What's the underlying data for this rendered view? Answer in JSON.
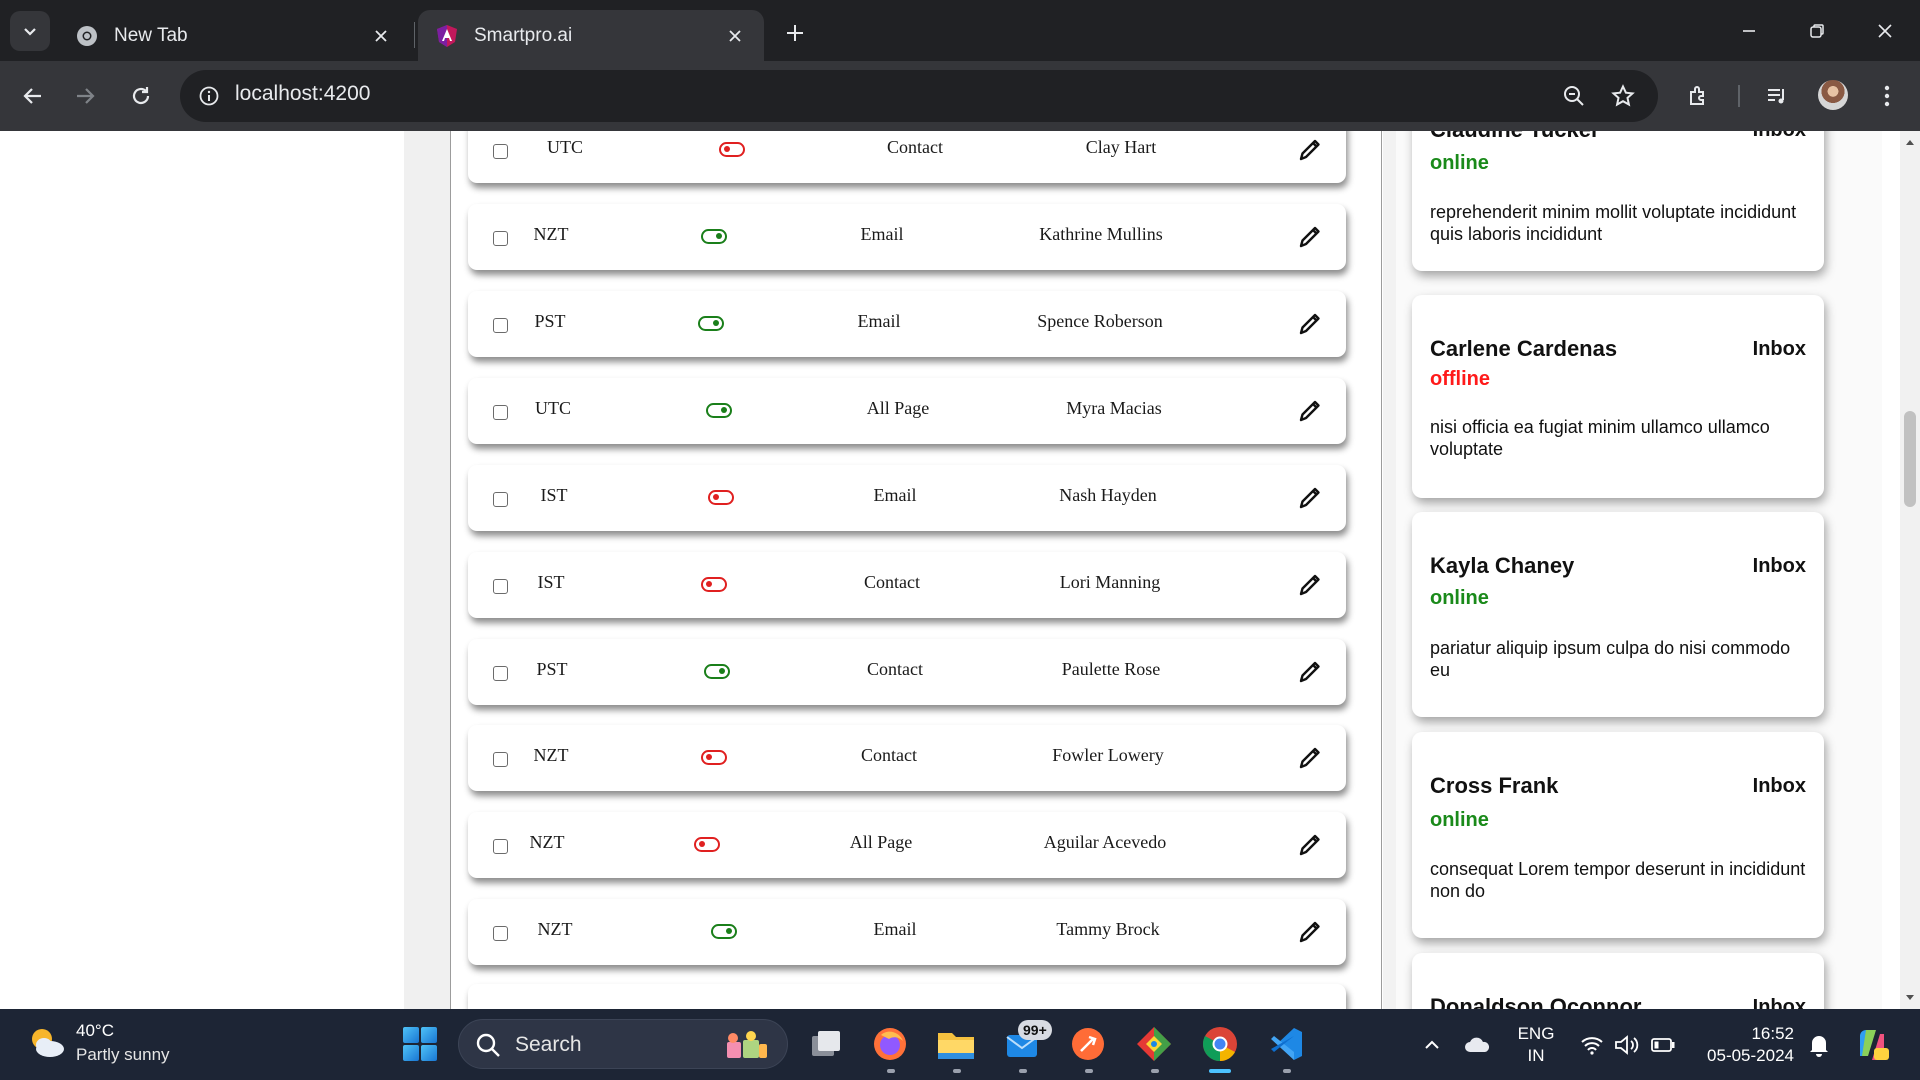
{
  "browser": {
    "tabs": [
      {
        "title": "New Tab",
        "active": false
      },
      {
        "title": "Smartpro.ai",
        "active": true
      }
    ],
    "url": "localhost:4200"
  },
  "table_rows": [
    {
      "timezone": "UTC",
      "enabled": false,
      "channel": "Contact",
      "name": "Clay Hart"
    },
    {
      "timezone": "NZT",
      "enabled": true,
      "channel": "Email",
      "name": "Kathrine Mullins"
    },
    {
      "timezone": "PST",
      "enabled": true,
      "channel": "Email",
      "name": "Spence Roberson"
    },
    {
      "timezone": "UTC",
      "enabled": true,
      "channel": "All Page",
      "name": "Myra Macias"
    },
    {
      "timezone": "IST",
      "enabled": false,
      "channel": "Email",
      "name": "Nash Hayden"
    },
    {
      "timezone": "IST",
      "enabled": false,
      "channel": "Contact",
      "name": "Lori Manning"
    },
    {
      "timezone": "PST",
      "enabled": true,
      "channel": "Contact",
      "name": "Paulette Rose"
    },
    {
      "timezone": "NZT",
      "enabled": false,
      "channel": "Contact",
      "name": "Fowler Lowery"
    },
    {
      "timezone": "NZT",
      "enabled": false,
      "channel": "All Page",
      "name": "Aguilar Acevedo"
    },
    {
      "timezone": "NZT",
      "enabled": true,
      "channel": "Email",
      "name": "Tammy Brock"
    }
  ],
  "contacts": [
    {
      "name": "Claudine Tucker",
      "folder": "Inbox",
      "status": "online",
      "message": "reprehenderit minim mollit voluptate incididunt quis laboris incididunt"
    },
    {
      "name": "Carlene Cardenas",
      "folder": "Inbox",
      "status": "offline",
      "message": "nisi officia ea fugiat minim ullamco ullamco voluptate"
    },
    {
      "name": "Kayla Chaney",
      "folder": "Inbox",
      "status": "online",
      "message": "pariatur aliquip ipsum culpa do nisi commodo eu"
    },
    {
      "name": "Cross Frank",
      "folder": "Inbox",
      "status": "online",
      "message": "consequat Lorem tempor deserunt in incididunt non do"
    },
    {
      "name": "Donaldson Oconnor",
      "folder": "Inbox",
      "status": "",
      "message": ""
    }
  ],
  "taskbar": {
    "weather_temp": "40°C",
    "weather_desc": "Partly sunny",
    "search_label": "Search",
    "notification_badge": "99+",
    "lang_line1": "ENG",
    "lang_line2": "IN",
    "time": "16:52",
    "date": "05-05-2024"
  },
  "colors": {
    "online": "#1a8a1a",
    "offline": "#ff1a1a",
    "toggle_on": "#1a7f1a",
    "toggle_off": "#e02020"
  }
}
